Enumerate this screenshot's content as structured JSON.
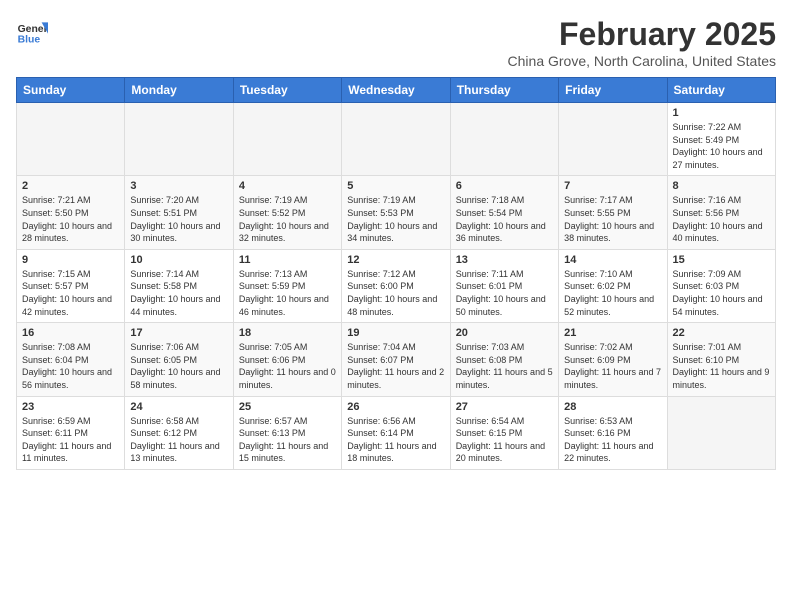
{
  "header": {
    "logo_general": "General",
    "logo_blue": "Blue",
    "month_title": "February 2025",
    "location": "China Grove, North Carolina, United States"
  },
  "days_of_week": [
    "Sunday",
    "Monday",
    "Tuesday",
    "Wednesday",
    "Thursday",
    "Friday",
    "Saturday"
  ],
  "weeks": [
    [
      {
        "num": "",
        "info": ""
      },
      {
        "num": "",
        "info": ""
      },
      {
        "num": "",
        "info": ""
      },
      {
        "num": "",
        "info": ""
      },
      {
        "num": "",
        "info": ""
      },
      {
        "num": "",
        "info": ""
      },
      {
        "num": "1",
        "info": "Sunrise: 7:22 AM\nSunset: 5:49 PM\nDaylight: 10 hours and 27 minutes."
      }
    ],
    [
      {
        "num": "2",
        "info": "Sunrise: 7:21 AM\nSunset: 5:50 PM\nDaylight: 10 hours and 28 minutes."
      },
      {
        "num": "3",
        "info": "Sunrise: 7:20 AM\nSunset: 5:51 PM\nDaylight: 10 hours and 30 minutes."
      },
      {
        "num": "4",
        "info": "Sunrise: 7:19 AM\nSunset: 5:52 PM\nDaylight: 10 hours and 32 minutes."
      },
      {
        "num": "5",
        "info": "Sunrise: 7:19 AM\nSunset: 5:53 PM\nDaylight: 10 hours and 34 minutes."
      },
      {
        "num": "6",
        "info": "Sunrise: 7:18 AM\nSunset: 5:54 PM\nDaylight: 10 hours and 36 minutes."
      },
      {
        "num": "7",
        "info": "Sunrise: 7:17 AM\nSunset: 5:55 PM\nDaylight: 10 hours and 38 minutes."
      },
      {
        "num": "8",
        "info": "Sunrise: 7:16 AM\nSunset: 5:56 PM\nDaylight: 10 hours and 40 minutes."
      }
    ],
    [
      {
        "num": "9",
        "info": "Sunrise: 7:15 AM\nSunset: 5:57 PM\nDaylight: 10 hours and 42 minutes."
      },
      {
        "num": "10",
        "info": "Sunrise: 7:14 AM\nSunset: 5:58 PM\nDaylight: 10 hours and 44 minutes."
      },
      {
        "num": "11",
        "info": "Sunrise: 7:13 AM\nSunset: 5:59 PM\nDaylight: 10 hours and 46 minutes."
      },
      {
        "num": "12",
        "info": "Sunrise: 7:12 AM\nSunset: 6:00 PM\nDaylight: 10 hours and 48 minutes."
      },
      {
        "num": "13",
        "info": "Sunrise: 7:11 AM\nSunset: 6:01 PM\nDaylight: 10 hours and 50 minutes."
      },
      {
        "num": "14",
        "info": "Sunrise: 7:10 AM\nSunset: 6:02 PM\nDaylight: 10 hours and 52 minutes."
      },
      {
        "num": "15",
        "info": "Sunrise: 7:09 AM\nSunset: 6:03 PM\nDaylight: 10 hours and 54 minutes."
      }
    ],
    [
      {
        "num": "16",
        "info": "Sunrise: 7:08 AM\nSunset: 6:04 PM\nDaylight: 10 hours and 56 minutes."
      },
      {
        "num": "17",
        "info": "Sunrise: 7:06 AM\nSunset: 6:05 PM\nDaylight: 10 hours and 58 minutes."
      },
      {
        "num": "18",
        "info": "Sunrise: 7:05 AM\nSunset: 6:06 PM\nDaylight: 11 hours and 0 minutes."
      },
      {
        "num": "19",
        "info": "Sunrise: 7:04 AM\nSunset: 6:07 PM\nDaylight: 11 hours and 2 minutes."
      },
      {
        "num": "20",
        "info": "Sunrise: 7:03 AM\nSunset: 6:08 PM\nDaylight: 11 hours and 5 minutes."
      },
      {
        "num": "21",
        "info": "Sunrise: 7:02 AM\nSunset: 6:09 PM\nDaylight: 11 hours and 7 minutes."
      },
      {
        "num": "22",
        "info": "Sunrise: 7:01 AM\nSunset: 6:10 PM\nDaylight: 11 hours and 9 minutes."
      }
    ],
    [
      {
        "num": "23",
        "info": "Sunrise: 6:59 AM\nSunset: 6:11 PM\nDaylight: 11 hours and 11 minutes."
      },
      {
        "num": "24",
        "info": "Sunrise: 6:58 AM\nSunset: 6:12 PM\nDaylight: 11 hours and 13 minutes."
      },
      {
        "num": "25",
        "info": "Sunrise: 6:57 AM\nSunset: 6:13 PM\nDaylight: 11 hours and 15 minutes."
      },
      {
        "num": "26",
        "info": "Sunrise: 6:56 AM\nSunset: 6:14 PM\nDaylight: 11 hours and 18 minutes."
      },
      {
        "num": "27",
        "info": "Sunrise: 6:54 AM\nSunset: 6:15 PM\nDaylight: 11 hours and 20 minutes."
      },
      {
        "num": "28",
        "info": "Sunrise: 6:53 AM\nSunset: 6:16 PM\nDaylight: 11 hours and 22 minutes."
      },
      {
        "num": "",
        "info": ""
      }
    ]
  ]
}
